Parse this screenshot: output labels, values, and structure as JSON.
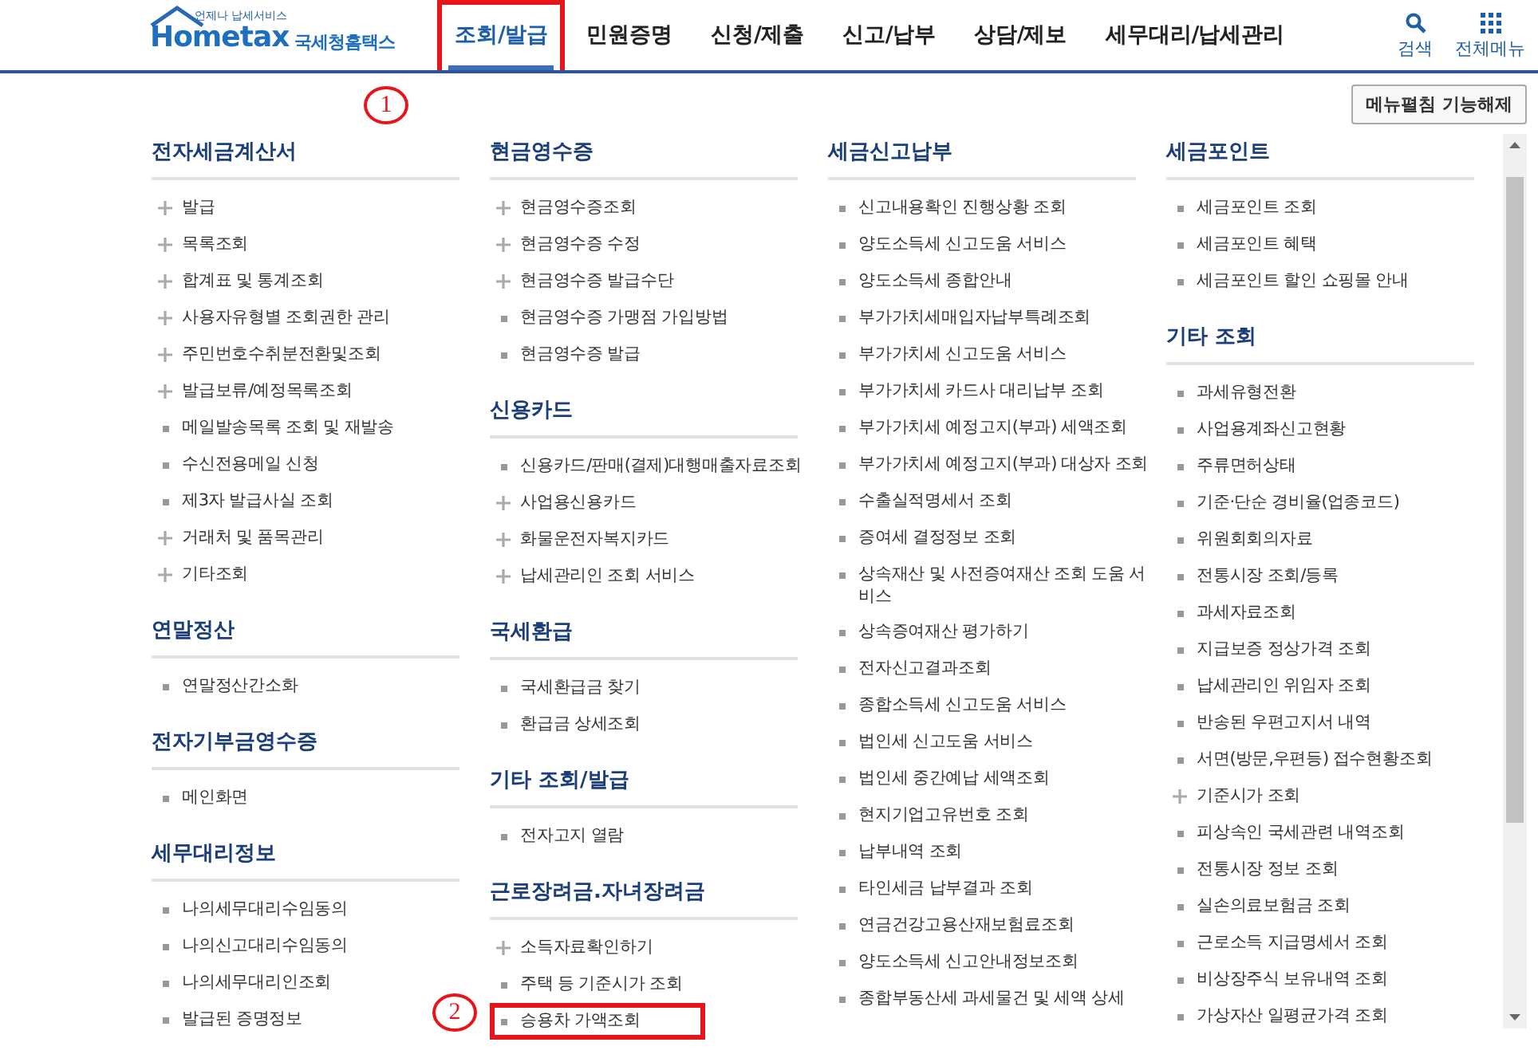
{
  "logo": {
    "tagline": "언제나 납세서비스",
    "wordmark": "Hometax",
    "name": "국세청홈택스"
  },
  "nav": [
    {
      "label": "조회/발급",
      "selected": true,
      "boxed": true,
      "marker": "1"
    },
    {
      "label": "민원증명",
      "selected": false,
      "boxed": false
    },
    {
      "label": "신청/제출",
      "selected": false,
      "boxed": false
    },
    {
      "label": "신고/납부",
      "selected": false,
      "boxed": false
    },
    {
      "label": "상담/제보",
      "selected": false,
      "boxed": false
    },
    {
      "label": "세무대리/납세관리",
      "selected": false,
      "boxed": false
    }
  ],
  "header_actions": [
    {
      "kind": "search",
      "label": "검색"
    },
    {
      "kind": "menu",
      "label": "전체메뉴"
    }
  ],
  "toggle_button": "메뉴펼침 기능해제",
  "columns": [
    {
      "sections": [
        {
          "title": "전자세금계산서",
          "items": [
            {
              "kind": "plus",
              "label": "발급",
              "boxed": false
            },
            {
              "kind": "plus",
              "label": "목록조회",
              "boxed": false
            },
            {
              "kind": "plus",
              "label": "합계표 및 통계조회",
              "boxed": false
            },
            {
              "kind": "plus",
              "label": "사용자유형별 조회권한 관리",
              "boxed": false
            },
            {
              "kind": "plus",
              "label": "주민번호수취분전환및조회",
              "boxed": false
            },
            {
              "kind": "plus",
              "label": "발급보류/예정목록조회",
              "boxed": false
            },
            {
              "kind": "bullet",
              "label": "메일발송목록 조회 및 재발송",
              "boxed": false
            },
            {
              "kind": "bullet",
              "label": "수신전용메일 신청",
              "boxed": false
            },
            {
              "kind": "bullet",
              "label": "제3자 발급사실 조회",
              "boxed": false
            },
            {
              "kind": "plus",
              "label": "거래처 및 품목관리",
              "boxed": false
            },
            {
              "kind": "plus",
              "label": "기타조회",
              "boxed": false
            }
          ]
        },
        {
          "title": "연말정산",
          "items": [
            {
              "kind": "bullet",
              "label": "연말정산간소화",
              "boxed": false
            }
          ]
        },
        {
          "title": "전자기부금영수증",
          "items": [
            {
              "kind": "bullet",
              "label": "메인화면",
              "boxed": false
            }
          ]
        },
        {
          "title": "세무대리정보",
          "items": [
            {
              "kind": "bullet",
              "label": "나의세무대리수임동의",
              "boxed": false
            },
            {
              "kind": "bullet",
              "label": "나의신고대리수임동의",
              "boxed": false
            },
            {
              "kind": "bullet",
              "label": "나의세무대리인조회",
              "boxed": false
            },
            {
              "kind": "bullet",
              "label": "발급된 증명정보",
              "boxed": false
            }
          ]
        }
      ]
    },
    {
      "sections": [
        {
          "title": "현금영수증",
          "items": [
            {
              "kind": "plus",
              "label": "현금영수증조회",
              "boxed": false
            },
            {
              "kind": "plus",
              "label": "현금영수증 수정",
              "boxed": false
            },
            {
              "kind": "plus",
              "label": "현금영수증 발급수단",
              "boxed": false
            },
            {
              "kind": "bullet",
              "label": "현금영수증 가맹점 가입방법",
              "boxed": false
            },
            {
              "kind": "bullet",
              "label": "현금영수증 발급",
              "boxed": false
            }
          ]
        },
        {
          "title": "신용카드",
          "items": [
            {
              "kind": "bullet",
              "label": "신용카드/판매(결제)대행매출자료조회",
              "boxed": false
            },
            {
              "kind": "plus",
              "label": "사업용신용카드",
              "boxed": false
            },
            {
              "kind": "plus",
              "label": "화물운전자복지카드",
              "boxed": false
            },
            {
              "kind": "plus",
              "label": "납세관리인 조회 서비스",
              "boxed": false
            }
          ]
        },
        {
          "title": "국세환급",
          "items": [
            {
              "kind": "bullet",
              "label": "국세환급금 찾기",
              "boxed": false
            },
            {
              "kind": "bullet",
              "label": "환급금 상세조회",
              "boxed": false
            }
          ]
        },
        {
          "title": "기타 조회/발급",
          "items": [
            {
              "kind": "bullet",
              "label": "전자고지 열람",
              "boxed": false
            }
          ]
        },
        {
          "title": "근로장려금.자녀장려금",
          "items": [
            {
              "kind": "plus",
              "label": "소득자료확인하기",
              "boxed": false
            },
            {
              "kind": "bullet",
              "label": "주택 등 기준시가 조회",
              "boxed": false
            },
            {
              "kind": "bullet",
              "label": "승용차 가액조회",
              "boxed": true,
              "marker": "2"
            }
          ]
        }
      ]
    },
    {
      "sections": [
        {
          "title": "세금신고납부",
          "items": [
            {
              "kind": "bullet",
              "label": "신고내용확인 진행상황 조회",
              "boxed": false
            },
            {
              "kind": "bullet",
              "label": "양도소득세 신고도움 서비스",
              "boxed": false
            },
            {
              "kind": "bullet",
              "label": "양도소득세 종합안내",
              "boxed": false
            },
            {
              "kind": "bullet",
              "label": "부가가치세매입자납부특례조회",
              "boxed": false
            },
            {
              "kind": "bullet",
              "label": "부가가치세 신고도움 서비스",
              "boxed": false
            },
            {
              "kind": "bullet",
              "label": "부가가치세 카드사 대리납부 조회",
              "boxed": false
            },
            {
              "kind": "bullet",
              "label": "부가가치세 예정고지(부과) 세액조회",
              "boxed": false
            },
            {
              "kind": "bullet",
              "label": "부가가치세 예정고지(부과) 대상자 조회",
              "boxed": false
            },
            {
              "kind": "bullet",
              "label": "수출실적명세서 조회",
              "boxed": false
            },
            {
              "kind": "bullet",
              "label": "증여세 결정정보 조회",
              "boxed": false
            },
            {
              "kind": "bullet",
              "label": "상속재산 및 사전증여재산 조회 도움 서비스",
              "boxed": false
            },
            {
              "kind": "bullet",
              "label": "상속증여재산 평가하기",
              "boxed": false
            },
            {
              "kind": "bullet",
              "label": "전자신고결과조회",
              "boxed": false
            },
            {
              "kind": "bullet",
              "label": "종합소득세 신고도움 서비스",
              "boxed": false
            },
            {
              "kind": "bullet",
              "label": "법인세 신고도움 서비스",
              "boxed": false
            },
            {
              "kind": "bullet",
              "label": "법인세 중간예납 세액조회",
              "boxed": false
            },
            {
              "kind": "bullet",
              "label": "현지기업고유번호 조회",
              "boxed": false
            },
            {
              "kind": "bullet",
              "label": "납부내역 조회",
              "boxed": false
            },
            {
              "kind": "bullet",
              "label": "타인세금 납부결과 조회",
              "boxed": false
            },
            {
              "kind": "bullet",
              "label": "연금건강고용산재보험료조회",
              "boxed": false
            },
            {
              "kind": "bullet",
              "label": "양도소득세 신고안내정보조회",
              "boxed": false
            },
            {
              "kind": "bullet",
              "label": "종합부동산세 과세물건 및 세액 상세",
              "boxed": false
            }
          ]
        }
      ]
    },
    {
      "sections": [
        {
          "title": "세금포인트",
          "items": [
            {
              "kind": "bullet",
              "label": "세금포인트 조회",
              "boxed": false
            },
            {
              "kind": "bullet",
              "label": "세금포인트 혜택",
              "boxed": false
            },
            {
              "kind": "bullet",
              "label": "세금포인트 할인 쇼핑몰 안내",
              "boxed": false
            }
          ]
        },
        {
          "title": "기타 조회",
          "items": [
            {
              "kind": "bullet",
              "label": "과세유형전환",
              "boxed": false
            },
            {
              "kind": "bullet",
              "label": "사업용계좌신고현황",
              "boxed": false
            },
            {
              "kind": "bullet",
              "label": "주류면허상태",
              "boxed": false
            },
            {
              "kind": "bullet",
              "label": "기준·단순 경비율(업종코드)",
              "boxed": false
            },
            {
              "kind": "bullet",
              "label": "위원회회의자료",
              "boxed": false
            },
            {
              "kind": "bullet",
              "label": "전통시장 조회/등록",
              "boxed": false
            },
            {
              "kind": "bullet",
              "label": "과세자료조회",
              "boxed": false
            },
            {
              "kind": "bullet",
              "label": "지급보증 정상가격 조회",
              "boxed": false
            },
            {
              "kind": "bullet",
              "label": "납세관리인 위임자 조회",
              "boxed": false
            },
            {
              "kind": "bullet",
              "label": "반송된 우편고지서 내역",
              "boxed": false
            },
            {
              "kind": "bullet",
              "label": "서면(방문,우편등) 접수현황조회",
              "boxed": false
            },
            {
              "kind": "plus",
              "label": "기준시가 조회",
              "boxed": false
            },
            {
              "kind": "bullet",
              "label": "피상속인 국세관련 내역조회",
              "boxed": false
            },
            {
              "kind": "bullet",
              "label": "전통시장 정보 조회",
              "boxed": false
            },
            {
              "kind": "bullet",
              "label": "실손의료보험금 조회",
              "boxed": false
            },
            {
              "kind": "bullet",
              "label": "근로소득 지급명세서 조회",
              "boxed": false
            },
            {
              "kind": "bullet",
              "label": "비상장주식 보유내역 조회",
              "boxed": false
            },
            {
              "kind": "bullet",
              "label": "가상자산 일평균가격 조회",
              "boxed": false
            }
          ]
        }
      ]
    }
  ]
}
